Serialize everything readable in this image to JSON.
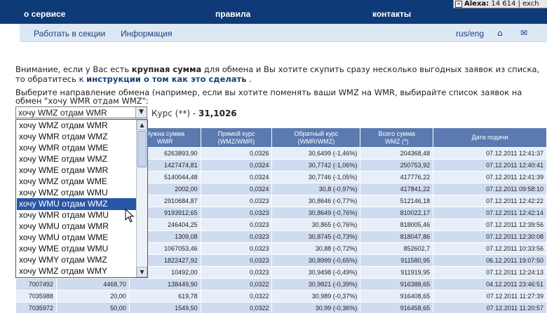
{
  "alexa": {
    "label": "Alexa:",
    "value": "14 614",
    "suffix": "| exch"
  },
  "nav": {
    "service": "о сервисе",
    "rules": "правила",
    "contacts": "контакты"
  },
  "subnav": {
    "work": "Работать в секции",
    "info": "Информация",
    "lang": "rus/eng"
  },
  "icons": {
    "home": "home-icon",
    "mail": "mail-icon"
  },
  "notice": {
    "part1": "Внимание, если у Вас есть",
    "bold": "крупная сумма",
    "part2": "для обмена и Вы хотите скупить сразу несколько выгодных заявок из списка, то обратитесь к",
    "link": "инструкции о том как это сделать",
    "end": "."
  },
  "direction": {
    "text": "Выберите направление обмена (например, если вы хотите поменять ваши WMZ на WMR, выбирайте список заявок на обмен \"хочу WMR отдам WMZ\":"
  },
  "select": {
    "value": "хочу WMZ отдам WMR"
  },
  "rate": {
    "label": "Курс (**) -",
    "value": "31,1026"
  },
  "dropdown": {
    "options": [
      "хочу WMZ отдам WMR",
      "хочу WMR отдам WMZ",
      "хочу WMR отдам WME",
      "хочу WME отдам WMZ",
      "хочу WME отдам WMR",
      "хочу WMZ отдам WME",
      "хочу WMZ отдам WMU",
      "хочу WMU отдам WMZ",
      "хочу WMR отдам WMU",
      "хочу WMU отдам WMR",
      "хочу WMU отдам WME",
      "хочу WME отдам WMU",
      "хочу WMY отдам WMZ",
      "хочу WMZ отдам WMY"
    ],
    "selected_index": 7
  },
  "table": {
    "headers": [
      "",
      "",
      "Нужна сумма\nWMR",
      "Прямой курс\n(WMZ/WMR)",
      "Обратный курс\n(WMR/WMZ)",
      "Всего сумма\nWMZ (*)",
      "Дата подачи"
    ],
    "rows": [
      [
        "",
        "",
        "6263893,90",
        "0,0326",
        "30,6499 (-1,46%)",
        "204368,48",
        "07.12.2011 12:41:37"
      ],
      [
        "",
        "",
        "1427474,81",
        "0,0324",
        "30,7742 (-1,06%)",
        "250753,92",
        "07.12.2011 12:40:41"
      ],
      [
        "",
        "",
        "5140044,48",
        "0,0324",
        "30,7746 (-1,05%)",
        "417776,22",
        "07.12.2011 12:41:39"
      ],
      [
        "",
        "",
        "2002,00",
        "0,0324",
        "30,8 (-0,97%)",
        "417841,22",
        "07.12.2011 09:58:10"
      ],
      [
        "",
        "",
        "2910684,87",
        "0,0323",
        "30,8646 (-0,77%)",
        "512146,18",
        "07.12.2011 12:42:22"
      ],
      [
        "",
        "",
        "9193912,65",
        "0,0323",
        "30,8649 (-0,76%)",
        "810022,17",
        "07.12.2011 12:42:14"
      ],
      [
        "",
        "",
        "246404,25",
        "0,0323",
        "30,865 (-0,76%)",
        "818005,46",
        "07.12.2011 12:39:56"
      ],
      [
        "",
        "",
        "1309,08",
        "0,0323",
        "30,8745 (-0,73%)",
        "818047,86",
        "07.12.2011 12:30:08"
      ],
      [
        "",
        "",
        "1067053,46",
        "0,0323",
        "30,88 (-0,72%)",
        "852602,7",
        "07.12.2011 10:33:56"
      ],
      [
        "",
        "",
        "1822427,92",
        "0,0323",
        "30,8999 (-0,65%)",
        "911580,95",
        "06.12.2011 19:07:50"
      ],
      [
        "",
        "",
        "10492,00",
        "0,0323",
        "30,9498 (-0,49%)",
        "911919,95",
        "07.12.2011 12:24:13"
      ],
      [
        "7007492",
        "4468,70",
        "138449,90",
        "0,0322",
        "30,9821 (-0,39%)",
        "916388,65",
        "04.12.2011 23:46:51"
      ],
      [
        "7035988",
        "20,00",
        "619,78",
        "0,0322",
        "30,989 (-0,37%)",
        "916408,65",
        "07.12.2011 11:27:39"
      ],
      [
        "7035972",
        "50,00",
        "1549,50",
        "0,0322",
        "30,99 (-0,36%)",
        "916458,65",
        "07.12.2011 11:20:57"
      ]
    ]
  }
}
